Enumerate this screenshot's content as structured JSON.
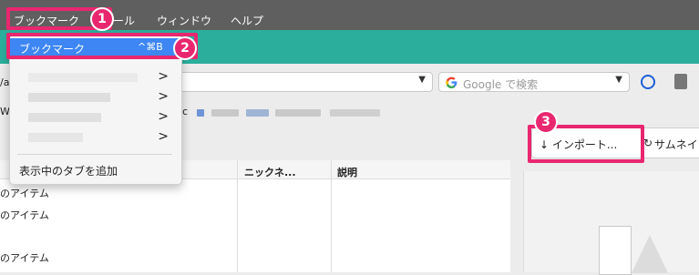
{
  "menubar": {
    "bookmarks": "ブックマーク",
    "tools_partial": "ール",
    "window": "ウィンドウ",
    "help": "ヘルプ"
  },
  "dropdown": {
    "highlighted_label": "ブックマーク",
    "shortcut": "^⌘B",
    "add_tab_label": "表示中のタブを追加",
    "submenu_arrow": ">"
  },
  "toolbar": {
    "search_placeholder": "Google で検索",
    "left_fragment": "/a",
    "w_fragment": "W",
    "c_fragment": "c"
  },
  "library": {
    "import_label": "↓ インポート...",
    "sync_label": "サムネイ"
  },
  "table": {
    "headers": [
      "ニックネ...",
      "説明"
    ],
    "rows": [
      "のアイテム",
      "のアイテム",
      "のアイテム"
    ]
  },
  "annotations": [
    "1",
    "2",
    "3"
  ],
  "colors": {
    "accent_pink": "#e8276f",
    "menu_blue": "#3d86f4",
    "teal": "#2cae9c"
  }
}
